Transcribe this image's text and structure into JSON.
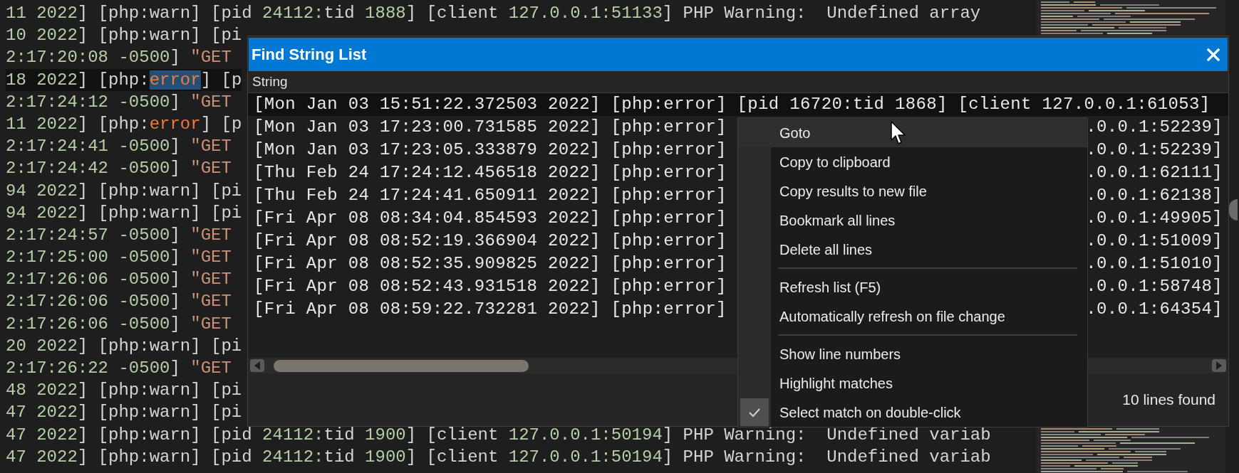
{
  "editor": {
    "lines": [
      {
        "text": "11 2022] [php:warn] [pid 24112:tid 1888] [client 127.0.0.1:51133] PHP Warning:  Undefined array",
        "kind": "warn",
        "selected": false
      },
      {
        "text": "10 2022] [php:warn] [pi",
        "kind": "warn",
        "selected": false
      },
      {
        "text": "2:17:20:08 -0500] \"GET",
        "kind": "request",
        "selected": false
      },
      {
        "text": "18 2022] [php:error] [p",
        "kind": "error",
        "selected": true
      },
      {
        "text": "2:17:24:12 -0500] \"GET",
        "kind": "request",
        "selected": false
      },
      {
        "text": "11 2022] [php:error] [p",
        "kind": "error",
        "selected": false
      },
      {
        "text": "2:17:24:41 -0500] \"GET",
        "kind": "request",
        "selected": false
      },
      {
        "text": "2:17:24:42 -0500] \"GET",
        "kind": "request",
        "selected": false
      },
      {
        "text": "94 2022] [php:warn] [pi",
        "kind": "warn",
        "selected": false
      },
      {
        "text": "94 2022] [php:warn] [pi",
        "kind": "warn",
        "selected": false
      },
      {
        "text": "2:17:24:57 -0500] \"GET",
        "kind": "request",
        "selected": false
      },
      {
        "text": "2:17:25:00 -0500] \"GET",
        "kind": "request",
        "selected": false
      },
      {
        "text": "2:17:26:06 -0500] \"GET",
        "kind": "request",
        "selected": false
      },
      {
        "text": "2:17:26:06 -0500] \"GET",
        "kind": "request",
        "selected": false
      },
      {
        "text": "2:17:26:06 -0500] \"GET",
        "kind": "request",
        "selected": false
      },
      {
        "text": "20 2022] [php:warn] [pi",
        "kind": "warn",
        "selected": false
      },
      {
        "text": "2:17:26:22 -0500] \"GET",
        "kind": "request",
        "selected": false
      },
      {
        "text": "48 2022] [php:warn] [pi",
        "kind": "warn",
        "selected": false
      },
      {
        "text": "47 2022] [php:warn] [pi",
        "kind": "warn",
        "selected": false
      },
      {
        "text": "47 2022] [php:warn] [pid 24112:tid 1900] [client 127.0.0.1:50194] PHP Warning:  Undefined variab",
        "kind": "warn",
        "selected": false
      },
      {
        "text": "47 2022] [php:warn] [pid 24112:tid 1900] [client 127.0.0.1:50194] PHP Warning:  Undefined variab",
        "kind": "warn",
        "selected": false
      }
    ]
  },
  "dialog": {
    "title": "Find String List",
    "column": "String",
    "rows": [
      {
        "text": "[Mon Jan 03 15:51:22.372503 2022] [php:error] [pid 16720:tid 1868] [client 127.0.0.1:61053]",
        "selected": true
      },
      {
        "text": "[Mon Jan 03 17:23:00.731585 2022] [php:error]",
        "text_right": ".0.0.1:52239]",
        "selected": false
      },
      {
        "text": "[Mon Jan 03 17:23:05.333879 2022] [php:error]",
        "text_right": ".0.0.1:52239]",
        "selected": false
      },
      {
        "text": "[Thu Feb 24 17:24:12.456518 2022] [php:error]",
        "text_right": ".0.0.1:62111]",
        "selected": false
      },
      {
        "text": "[Thu Feb 24 17:24:41.650911 2022] [php:error]",
        "text_right": ".0.0.1:62138]",
        "selected": false
      },
      {
        "text": "[Fri Apr 08 08:34:04.854593 2022] [php:error]",
        "text_right": ".0.0.1:49905]",
        "selected": false
      },
      {
        "text": "[Fri Apr 08 08:52:19.366904 2022] [php:error]",
        "text_right": ".0.0.1:51009]",
        "selected": false
      },
      {
        "text": "[Fri Apr 08 08:52:35.909825 2022] [php:error]",
        "text_right": ".0.0.1:51010]",
        "selected": false
      },
      {
        "text": "[Fri Apr 08 08:52:43.931518 2022] [php:error]",
        "text_right": ".0.0.1:58748]",
        "selected": false
      },
      {
        "text": "[Fri Apr 08 08:59:22.732281 2022] [php:error]",
        "text_right": ".0.0.1:64354]",
        "selected": false
      }
    ],
    "status": "10 lines found"
  },
  "context_menu": {
    "items": [
      {
        "kind": "command",
        "label": "Goto",
        "highlighted": true,
        "checked": false
      },
      {
        "kind": "command",
        "label": "Copy to clipboard",
        "highlighted": false,
        "checked": false
      },
      {
        "kind": "command",
        "label": "Copy results to new file",
        "highlighted": false,
        "checked": false
      },
      {
        "kind": "command",
        "label": "Bookmark all lines",
        "highlighted": false,
        "checked": false
      },
      {
        "kind": "command",
        "label": "Delete all lines",
        "highlighted": false,
        "checked": false
      },
      {
        "kind": "separator"
      },
      {
        "kind": "command",
        "label": "Refresh list (F5)",
        "highlighted": false,
        "checked": false
      },
      {
        "kind": "command",
        "label": "Automatically refresh on file change",
        "highlighted": false,
        "checked": false
      },
      {
        "kind": "separator"
      },
      {
        "kind": "command",
        "label": "Show line numbers",
        "highlighted": false,
        "checked": false
      },
      {
        "kind": "command",
        "label": "Highlight matches",
        "highlighted": false,
        "checked": false
      },
      {
        "kind": "command",
        "label": "Select match on double-click",
        "highlighted": false,
        "checked": true
      }
    ]
  }
}
